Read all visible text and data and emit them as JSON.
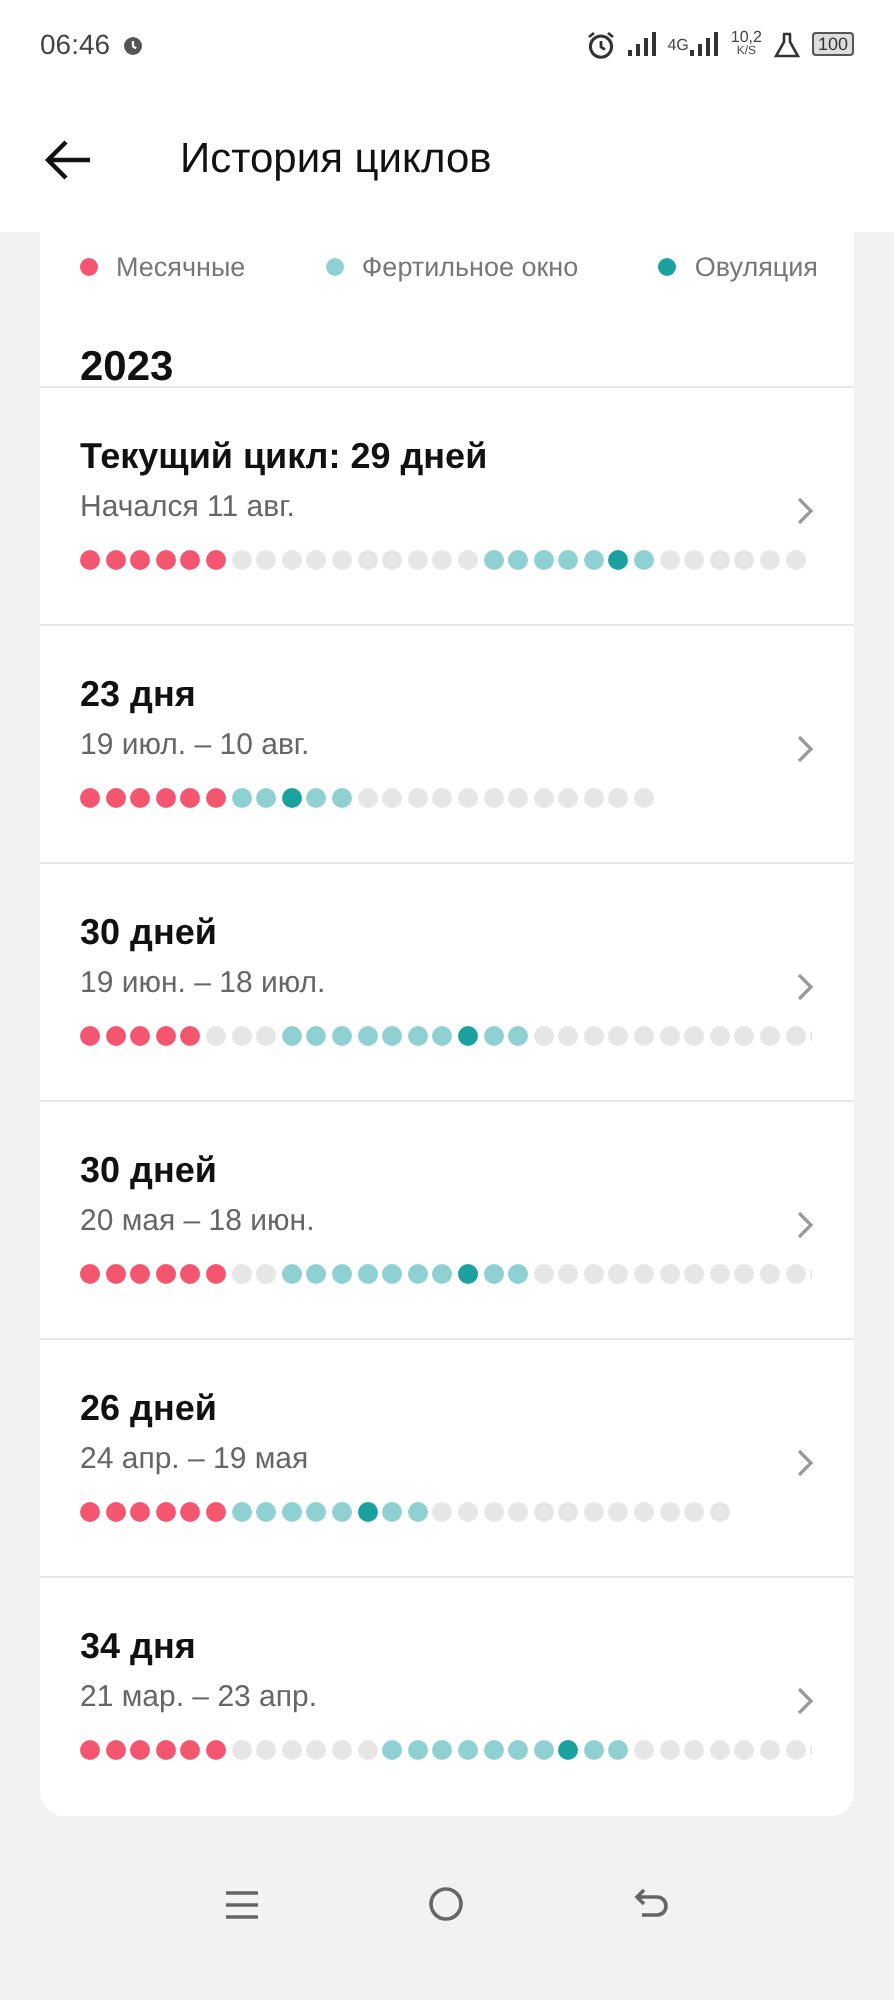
{
  "status_bar": {
    "time": "06:46",
    "network_label": "4G",
    "speed": "10,2",
    "speed_unit": "K/S",
    "battery": "100"
  },
  "header": {
    "title": "История циклов"
  },
  "legend": [
    {
      "label": "Месячные",
      "color": "#f4566f"
    },
    {
      "label": "Фертильное окно",
      "color": "#8fd1d3"
    },
    {
      "label": "Овуляция",
      "color": "#1ba1a0"
    }
  ],
  "year": "2023",
  "cycles": [
    {
      "title": "Текущий цикл: 29 дней",
      "subtitle": "Начался 11 авг.",
      "days": [
        {
          "kind": "period"
        },
        {
          "kind": "period"
        },
        {
          "kind": "period"
        },
        {
          "kind": "period"
        },
        {
          "kind": "period"
        },
        {
          "kind": "period"
        },
        {
          "kind": "none"
        },
        {
          "kind": "none"
        },
        {
          "kind": "none"
        },
        {
          "kind": "none"
        },
        {
          "kind": "none"
        },
        {
          "kind": "none"
        },
        {
          "kind": "none"
        },
        {
          "kind": "none"
        },
        {
          "kind": "none"
        },
        {
          "kind": "none"
        },
        {
          "kind": "fertile"
        },
        {
          "kind": "fertile"
        },
        {
          "kind": "fertile"
        },
        {
          "kind": "fertile"
        },
        {
          "kind": "fertile"
        },
        {
          "kind": "ovulation"
        },
        {
          "kind": "fertile"
        },
        {
          "kind": "none"
        },
        {
          "kind": "none"
        },
        {
          "kind": "none"
        },
        {
          "kind": "none"
        },
        {
          "kind": "none"
        },
        {
          "kind": "none"
        }
      ]
    },
    {
      "title": "23 дня",
      "subtitle": "19 июл. – 10 авг.",
      "days": [
        {
          "kind": "period"
        },
        {
          "kind": "period"
        },
        {
          "kind": "period"
        },
        {
          "kind": "period"
        },
        {
          "kind": "period"
        },
        {
          "kind": "period"
        },
        {
          "kind": "fertile"
        },
        {
          "kind": "fertile"
        },
        {
          "kind": "ovulation"
        },
        {
          "kind": "fertile"
        },
        {
          "kind": "fertile"
        },
        {
          "kind": "none"
        },
        {
          "kind": "none"
        },
        {
          "kind": "none"
        },
        {
          "kind": "none"
        },
        {
          "kind": "none"
        },
        {
          "kind": "none"
        },
        {
          "kind": "none"
        },
        {
          "kind": "none"
        },
        {
          "kind": "none"
        },
        {
          "kind": "none"
        },
        {
          "kind": "none"
        },
        {
          "kind": "none"
        }
      ]
    },
    {
      "title": "30 дней",
      "subtitle": "19 июн. – 18 июл.",
      "days": [
        {
          "kind": "period"
        },
        {
          "kind": "period"
        },
        {
          "kind": "period"
        },
        {
          "kind": "period"
        },
        {
          "kind": "period"
        },
        {
          "kind": "none"
        },
        {
          "kind": "none"
        },
        {
          "kind": "none"
        },
        {
          "kind": "fertile"
        },
        {
          "kind": "fertile"
        },
        {
          "kind": "fertile"
        },
        {
          "kind": "fertile"
        },
        {
          "kind": "fertile"
        },
        {
          "kind": "fertile"
        },
        {
          "kind": "fertile"
        },
        {
          "kind": "ovulation"
        },
        {
          "kind": "fertile"
        },
        {
          "kind": "fertile"
        },
        {
          "kind": "none"
        },
        {
          "kind": "none"
        },
        {
          "kind": "none"
        },
        {
          "kind": "none"
        },
        {
          "kind": "none"
        },
        {
          "kind": "none"
        },
        {
          "kind": "none"
        },
        {
          "kind": "none"
        },
        {
          "kind": "none"
        },
        {
          "kind": "none"
        },
        {
          "kind": "none"
        },
        {
          "kind": "none"
        }
      ]
    },
    {
      "title": "30 дней",
      "subtitle": "20 мая – 18 июн.",
      "days": [
        {
          "kind": "period"
        },
        {
          "kind": "period"
        },
        {
          "kind": "period"
        },
        {
          "kind": "period"
        },
        {
          "kind": "period"
        },
        {
          "kind": "period"
        },
        {
          "kind": "none"
        },
        {
          "kind": "none"
        },
        {
          "kind": "fertile"
        },
        {
          "kind": "fertile"
        },
        {
          "kind": "fertile"
        },
        {
          "kind": "fertile"
        },
        {
          "kind": "fertile"
        },
        {
          "kind": "fertile"
        },
        {
          "kind": "fertile"
        },
        {
          "kind": "ovulation"
        },
        {
          "kind": "fertile"
        },
        {
          "kind": "fertile"
        },
        {
          "kind": "none"
        },
        {
          "kind": "none"
        },
        {
          "kind": "none"
        },
        {
          "kind": "none"
        },
        {
          "kind": "none"
        },
        {
          "kind": "none"
        },
        {
          "kind": "none"
        },
        {
          "kind": "none"
        },
        {
          "kind": "none"
        },
        {
          "kind": "none"
        },
        {
          "kind": "none"
        },
        {
          "kind": "none"
        }
      ]
    },
    {
      "title": "26 дней",
      "subtitle": "24 апр. – 19 мая",
      "days": [
        {
          "kind": "period"
        },
        {
          "kind": "period"
        },
        {
          "kind": "period"
        },
        {
          "kind": "period"
        },
        {
          "kind": "period"
        },
        {
          "kind": "period"
        },
        {
          "kind": "fertile"
        },
        {
          "kind": "fertile"
        },
        {
          "kind": "fertile"
        },
        {
          "kind": "fertile"
        },
        {
          "kind": "fertile"
        },
        {
          "kind": "ovulation"
        },
        {
          "kind": "fertile"
        },
        {
          "kind": "fertile"
        },
        {
          "kind": "none"
        },
        {
          "kind": "none"
        },
        {
          "kind": "none"
        },
        {
          "kind": "none"
        },
        {
          "kind": "none"
        },
        {
          "kind": "none"
        },
        {
          "kind": "none"
        },
        {
          "kind": "none"
        },
        {
          "kind": "none"
        },
        {
          "kind": "none"
        },
        {
          "kind": "none"
        },
        {
          "kind": "none"
        }
      ]
    },
    {
      "title": "34 дня",
      "subtitle": "21 мар. – 23 апр.",
      "days": [
        {
          "kind": "period"
        },
        {
          "kind": "period"
        },
        {
          "kind": "period"
        },
        {
          "kind": "period"
        },
        {
          "kind": "period"
        },
        {
          "kind": "period"
        },
        {
          "kind": "none"
        },
        {
          "kind": "none"
        },
        {
          "kind": "none"
        },
        {
          "kind": "none"
        },
        {
          "kind": "none"
        },
        {
          "kind": "none"
        },
        {
          "kind": "fertile"
        },
        {
          "kind": "fertile"
        },
        {
          "kind": "fertile"
        },
        {
          "kind": "fertile"
        },
        {
          "kind": "fertile"
        },
        {
          "kind": "fertile"
        },
        {
          "kind": "fertile"
        },
        {
          "kind": "ovulation"
        },
        {
          "kind": "fertile"
        },
        {
          "kind": "fertile"
        },
        {
          "kind": "none"
        },
        {
          "kind": "none"
        },
        {
          "kind": "none"
        },
        {
          "kind": "none"
        },
        {
          "kind": "none"
        },
        {
          "kind": "none"
        },
        {
          "kind": "none"
        },
        {
          "kind": "none"
        }
      ]
    }
  ]
}
